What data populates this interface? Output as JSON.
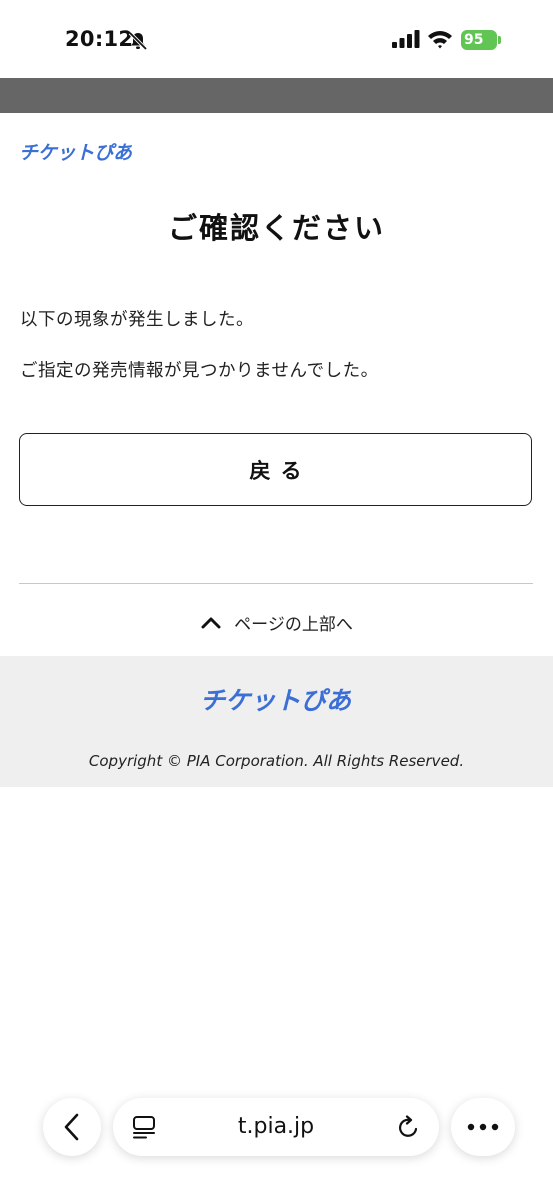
{
  "status_bar": {
    "time": "20:12",
    "battery": "95"
  },
  "brand": {
    "logo_text": "チケットぴあ",
    "logo_color": "#3b6fd6"
  },
  "main": {
    "title": "ご確認ください",
    "message_line1": "以下の現象が発生しました。",
    "message_line2": "ご指定の発売情報が見つかりませんでした。",
    "back_button": "戻る"
  },
  "page_top_link": "ページの上部へ",
  "footer": {
    "copyright": "Copyright © PIA Corporation. All Rights Reserved."
  },
  "browser": {
    "url": "t.pia.jp"
  },
  "colors": {
    "header_band": "#666666",
    "footer_bg": "#efefef",
    "battery_green": "#61c554"
  }
}
